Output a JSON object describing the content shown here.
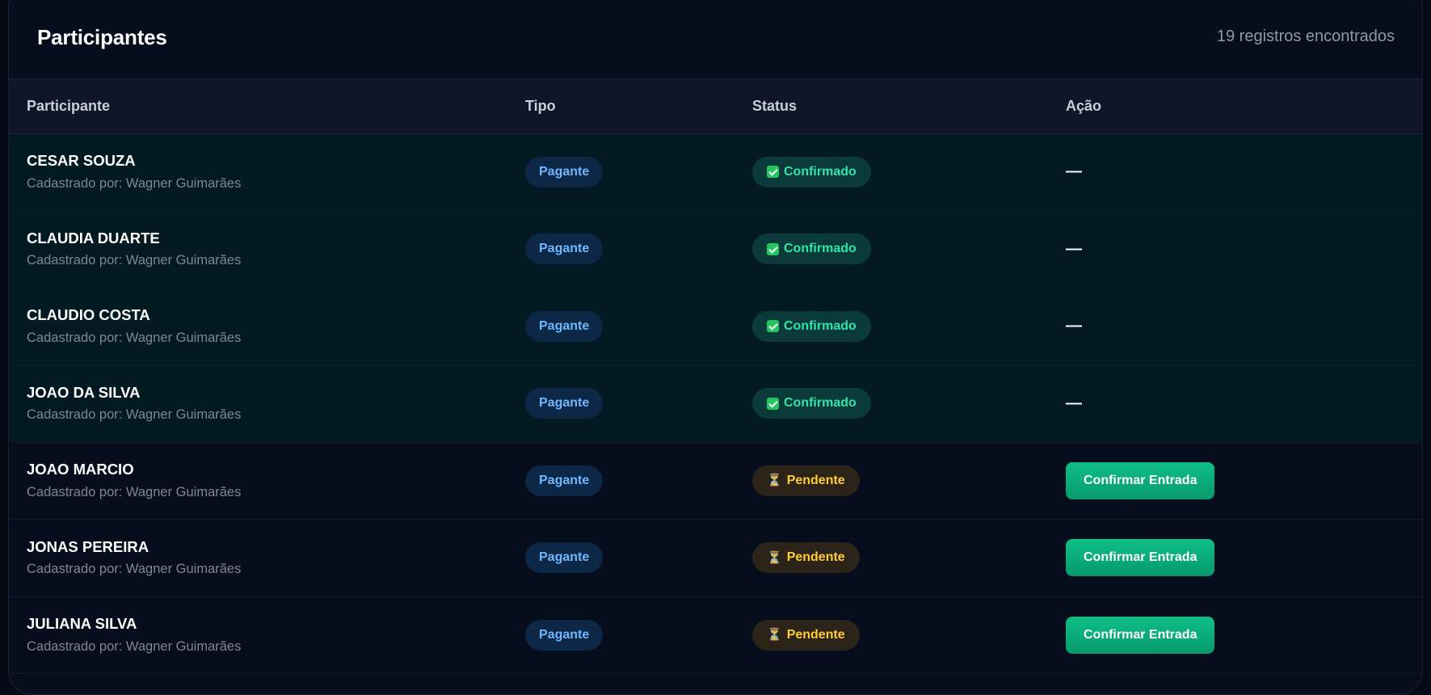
{
  "header": {
    "title": "Participantes",
    "count": "19 registros encontrados"
  },
  "table": {
    "columns": [
      "Participante",
      "Tipo",
      "Status",
      "Ação"
    ],
    "rows": [
      {
        "name": "CESAR SOUZA",
        "registered_by": "Cadastrado por: Wagner Guimarães",
        "type": "Pagante",
        "status": "Confirmado",
        "status_kind": "confirmed",
        "action": "—"
      },
      {
        "name": "CLAUDIA DUARTE",
        "registered_by": "Cadastrado por: Wagner Guimarães",
        "type": "Pagante",
        "status": "Confirmado",
        "status_kind": "confirmed",
        "action": "—"
      },
      {
        "name": "CLAUDIO COSTA",
        "registered_by": "Cadastrado por: Wagner Guimarães",
        "type": "Pagante",
        "status": "Confirmado",
        "status_kind": "confirmed",
        "action": "—"
      },
      {
        "name": "JOAO DA SILVA",
        "registered_by": "Cadastrado por: Wagner Guimarães",
        "type": "Pagante",
        "status": "Confirmado",
        "status_kind": "confirmed",
        "action": "—"
      },
      {
        "name": "JOAO MARCIO",
        "registered_by": "Cadastrado por: Wagner Guimarães",
        "type": "Pagante",
        "status": "Pendente",
        "status_kind": "pending",
        "action": "Confirmar Entrada"
      },
      {
        "name": "JONAS PEREIRA",
        "registered_by": "Cadastrado por: Wagner Guimarães",
        "type": "Pagante",
        "status": "Pendente",
        "status_kind": "pending",
        "action": "Confirmar Entrada"
      },
      {
        "name": "JULIANA SILVA",
        "registered_by": "Cadastrado por: Wagner Guimarães",
        "type": "Pagante",
        "status": "Pendente",
        "status_kind": "pending",
        "action": "Confirmar Entrada"
      }
    ]
  },
  "icons": {
    "confirmed": "check-box-icon",
    "pending": "hourglass-icon"
  },
  "colors": {
    "accent_green": "#0ebf85",
    "confirmed_text": "#2ee6a6",
    "pending_text": "#ffcc33",
    "type_badge_text": "#6fb8ff"
  }
}
